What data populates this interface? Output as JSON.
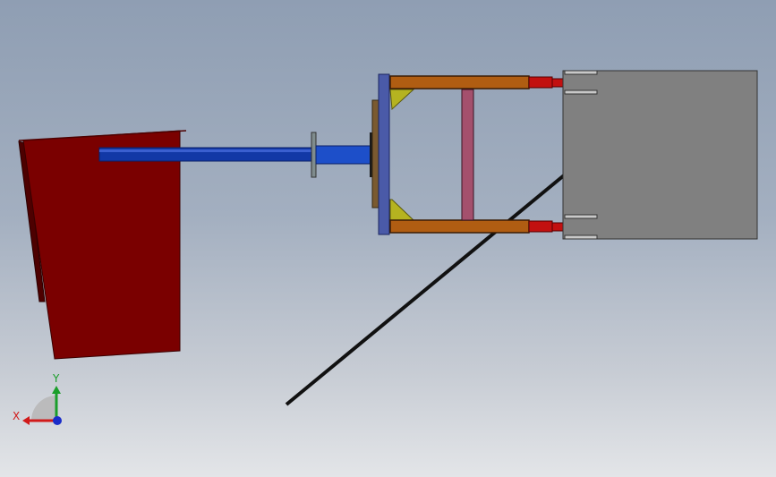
{
  "viewport": {
    "background_top": "#8f9eb3",
    "background_bottom": "#e3e5e8"
  },
  "colors": {
    "hopper": "#7a0000",
    "hopper_dark": "#4d0000",
    "shaft": "#1238a6",
    "flange": "#4a5aa8",
    "rails": "#b05d12",
    "rail_ends": "#c21010",
    "cross_bar": "#a4506d",
    "gussets": "#b5b320",
    "box": "#808080",
    "rod": "#111111"
  },
  "triad": {
    "x_label": "X",
    "y_label": "Y",
    "x_color": "#d11a1a",
    "y_color": "#1a9e2a",
    "z_color": "#1a2dc9"
  }
}
